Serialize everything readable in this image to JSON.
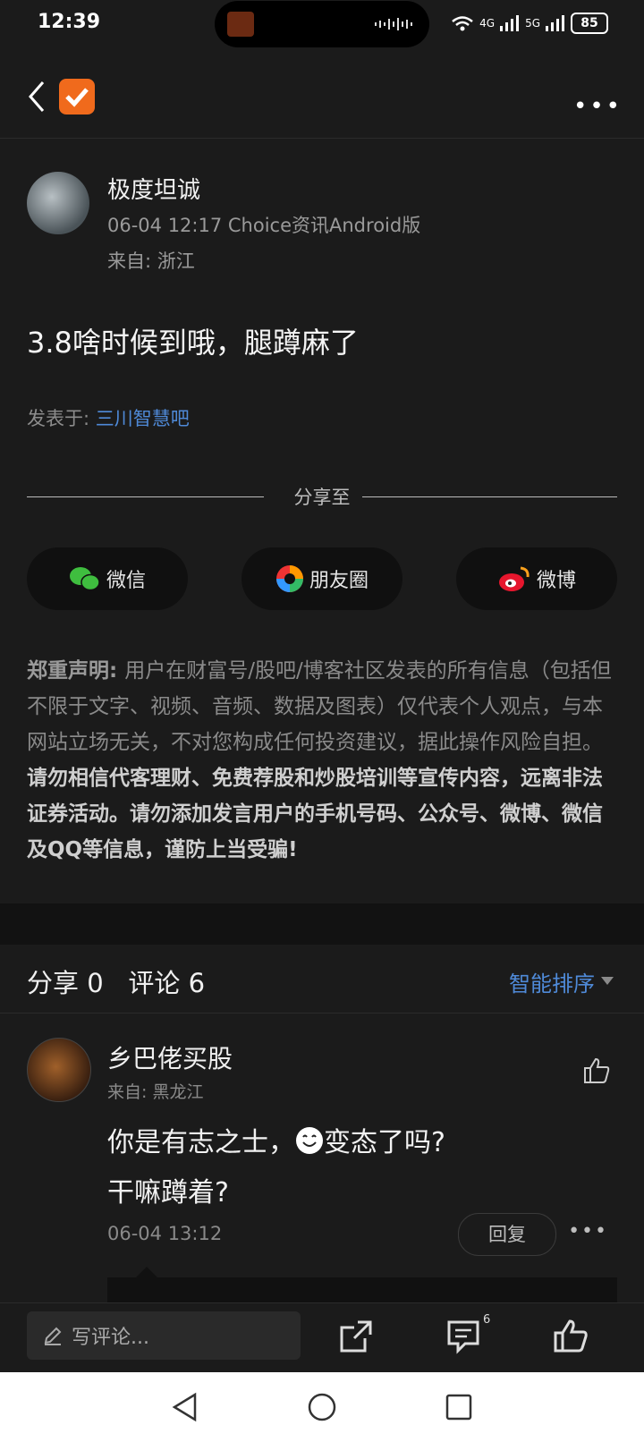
{
  "status_bar": {
    "time": "12:39",
    "net1": "4G",
    "net2": "5G",
    "battery": "85"
  },
  "post": {
    "author": "极度坦诚",
    "meta": "06-04 12:17 Choice资讯Android版",
    "from": "来自: 浙江",
    "content": "3.8啥时候到哦，腿蹲麻了",
    "posted_label": "发表于: ",
    "posted_link": "三川智慧吧"
  },
  "share": {
    "label": "分享至",
    "wechat": "微信",
    "moments": "朋友圈",
    "weibo": "微博"
  },
  "disclaimer": {
    "title": "郑重声明: ",
    "body": "用户在财富号/股吧/博客社区发表的所有信息（包括但不限于文字、视频、音频、数据及图表）仅代表个人观点，与本网站立场无关，不对您构成任何投资建议，据此操作风险自担。",
    "bold": "请勿相信代客理财、免费荐股和炒股培训等宣传内容，远离非法证券活动。请勿添加发言用户的手机号码、公众号、微博、微信及QQ等信息，谨防上当受骗!"
  },
  "stats": {
    "share_label": "分享",
    "share_count": "0",
    "comment_label": "评论",
    "comment_count": "6",
    "sort": "智能排序"
  },
  "comment": {
    "author": "乡巴佬买股",
    "from": "来自: 黑龙江",
    "line1a": "你是有志之士，",
    "line1b": "变态了吗?",
    "line2": "干嘛蹲着?",
    "time": "06-04 13:12",
    "reply": "回复"
  },
  "bottom": {
    "write_placeholder": "写评论...",
    "comment_badge": "6"
  },
  "colors": {
    "accent_blue": "#4f8ad8",
    "logo_orange": "#f06a1c",
    "bg": "#1b1b1b"
  }
}
